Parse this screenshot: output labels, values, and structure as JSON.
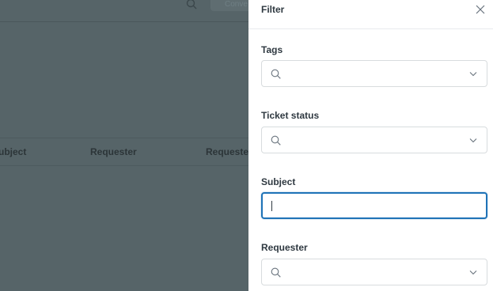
{
  "background": {
    "search_icon": "search-icon",
    "conversation_button_label": "Conve",
    "columns": [
      "ubject",
      "Requester",
      "Requeste"
    ]
  },
  "panel": {
    "title": "Filter",
    "close_icon": "close-icon",
    "fields": [
      {
        "label": "Tags",
        "value": "",
        "type": "select"
      },
      {
        "label": "Ticket status",
        "value": "",
        "type": "select"
      },
      {
        "label": "Subject",
        "value": "",
        "type": "text",
        "focused": true
      },
      {
        "label": "Requester",
        "value": "",
        "type": "select"
      }
    ]
  },
  "colors": {
    "overlay": "#566468",
    "focus_border": "#1f73b7",
    "label_text": "#2f3941"
  }
}
